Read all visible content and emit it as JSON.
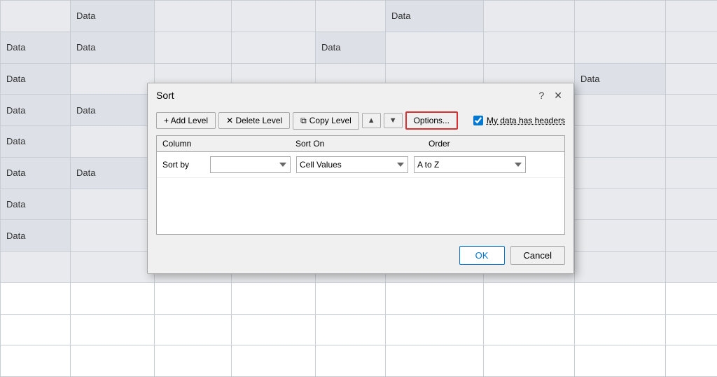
{
  "spreadsheet": {
    "rows": [
      [
        "",
        "Data",
        "",
        "",
        "",
        "Data",
        "",
        ""
      ],
      [
        "Data",
        "Data",
        "",
        "",
        "Data",
        "",
        "",
        ""
      ],
      [
        "Data",
        "",
        "",
        "",
        "",
        "",
        "",
        "Data"
      ],
      [
        "Data",
        "Data",
        "",
        "",
        "",
        "",
        "",
        ""
      ],
      [
        "Data",
        "",
        "",
        "",
        "",
        "",
        "",
        ""
      ],
      [
        "Data",
        "Data",
        "",
        "",
        "",
        "",
        "",
        ""
      ],
      [
        "Data",
        "",
        "",
        "",
        "",
        "",
        "",
        ""
      ],
      [
        "Data",
        "",
        "",
        "",
        "",
        "",
        "",
        ""
      ]
    ]
  },
  "dialog": {
    "title": "Sort",
    "help_label": "?",
    "close_label": "✕",
    "toolbar": {
      "add_level": "+ Add Level",
      "delete_level": "✕ Delete Level",
      "copy_level": "Copy Level",
      "move_up": "▲",
      "move_down": "▼",
      "options": "Options...",
      "my_data_headers_label": "My data has headers"
    },
    "table": {
      "headers": {
        "column": "Column",
        "sort_on": "Sort On",
        "order": "Order"
      },
      "row_label": "Sort by",
      "sort_on_value": "Cell Values",
      "order_value": "A to Z"
    },
    "footer": {
      "ok": "OK",
      "cancel": "Cancel"
    }
  }
}
